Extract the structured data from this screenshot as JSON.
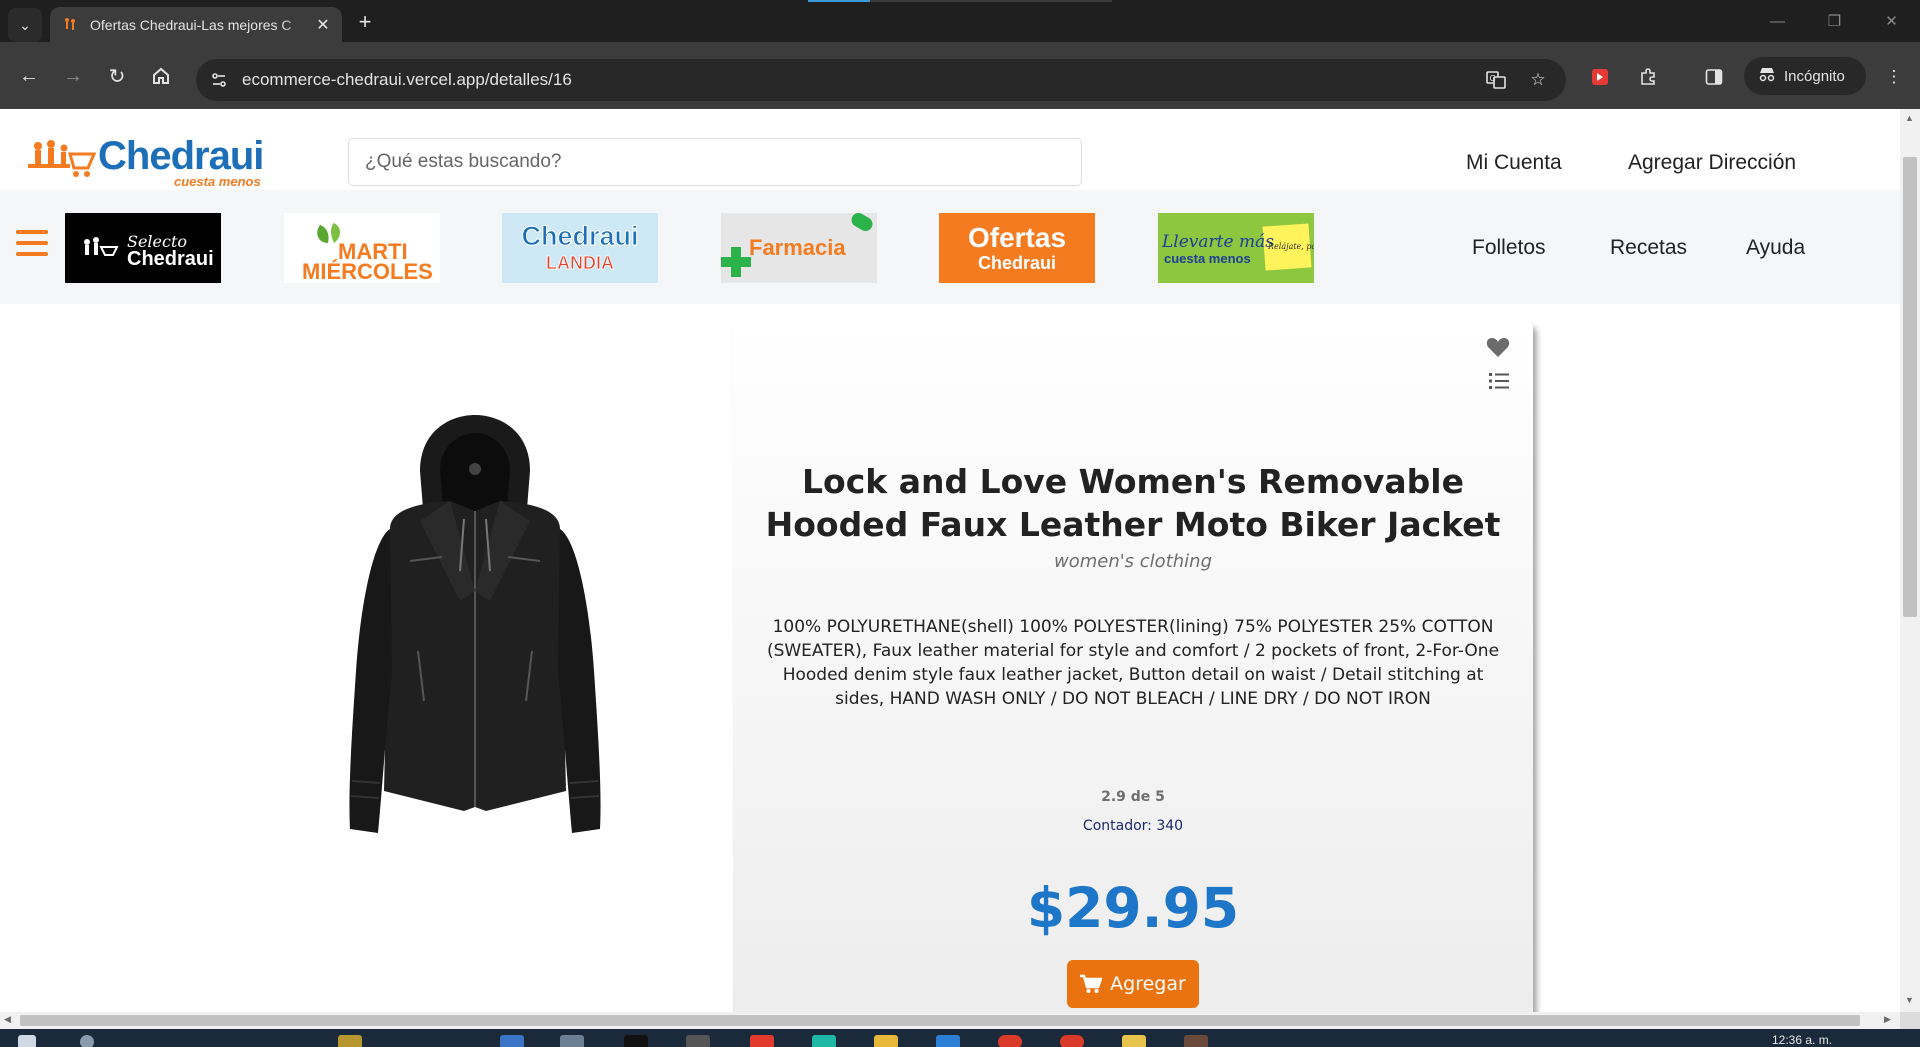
{
  "browser": {
    "tab_title": "Ofertas Chedraui-Las mejores C",
    "url": "ecommerce-chedraui.vercel.app/detalles/16",
    "incognito_label": "Incógnito",
    "new_tab": "+",
    "tab_close": "✕"
  },
  "header": {
    "logo_text": "Chedraui",
    "logo_tagline": "cuesta menos",
    "search_placeholder": "¿Qué estas buscando?",
    "links": [
      "Mi Cuenta",
      "Agregar Dirección"
    ]
  },
  "banners": {
    "selecto": {
      "small": "Selecto",
      "big": "Chedraui"
    },
    "martimiercoles": {
      "line1": "MARTI",
      "line2": "MIÉRCOLES"
    },
    "landia": {
      "line1": "Chedraui",
      "line2": "LANDIA"
    },
    "farmacia": "Farmacia",
    "ofertas": {
      "line1": "Ofertas",
      "line2": "Chedraui"
    },
    "llevarte": {
      "line1": "Llevarte más",
      "line2": "cuesta menos",
      "note": "Relájate, para ti"
    }
  },
  "nav": {
    "links": [
      "Folletos",
      "Recetas",
      "Ayuda"
    ]
  },
  "product": {
    "title": "Lock and Love Women's Removable Hooded Faux Leather Moto Biker Jacket",
    "category": "women's clothing",
    "description": "100% POLYURETHANE(shell) 100% POLYESTER(lining) 75% POLYESTER 25% COTTON (SWEATER), Faux leather material for style and comfort / 2 pockets of front, 2-For-One Hooded denim style faux leather jacket, Button detail on waist / Detail stitching at sides, HAND WASH ONLY / DO NOT BLEACH / LINE DRY / DO NOT IRON",
    "rating": "2.9 de 5",
    "counter": "Contador: 340",
    "price": "$29.95",
    "add_label": "Agregar"
  },
  "taskbar": {
    "clock": "12:36 a. m."
  },
  "colors": {
    "brand_orange": "#f47b20",
    "brand_blue": "#1d6fb8",
    "price_blue": "#1d76c8",
    "button_orange": "#ea730f"
  }
}
